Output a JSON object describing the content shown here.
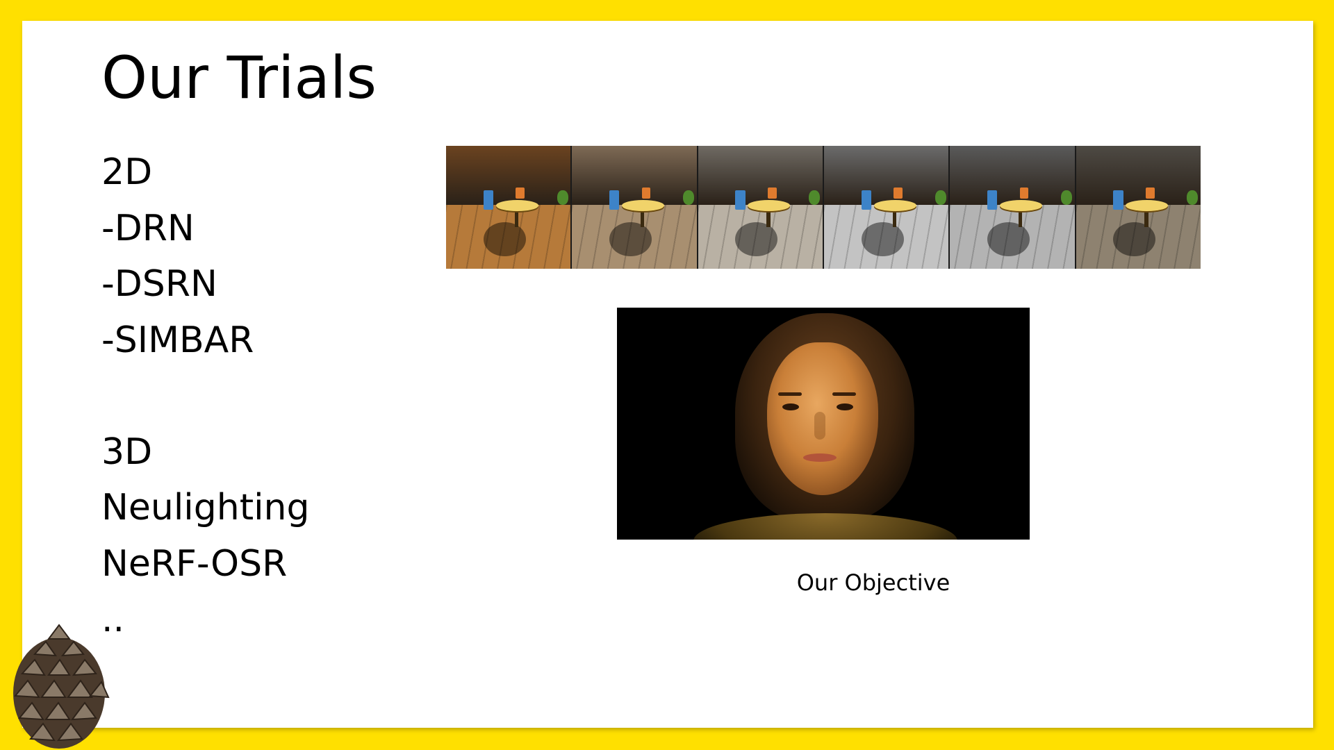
{
  "slide": {
    "title": "Our Trials",
    "bullets": [
      "2D",
      "-DRN",
      "-DSRN",
      "-SIMBAR",
      "",
      "3D",
      "Neulighting",
      "NeRF-OSR",
      ".."
    ],
    "caption": "Our Objective"
  },
  "colors": {
    "border": "#FFE000",
    "slide_background": "#FFFFFF",
    "text": "#000000"
  },
  "strip_frames": [
    {
      "wall": "#6b4320",
      "floor": "#b67a3a"
    },
    {
      "wall": "#7e6a55",
      "floor": "#a88f70"
    },
    {
      "wall": "#6f6a63",
      "floor": "#b9b1a4"
    },
    {
      "wall": "#6b6b6b",
      "floor": "#c3c3c3"
    },
    {
      "wall": "#5a5a5a",
      "floor": "#b3b3b3"
    },
    {
      "wall": "#4e4a44",
      "floor": "#8e8270"
    }
  ]
}
